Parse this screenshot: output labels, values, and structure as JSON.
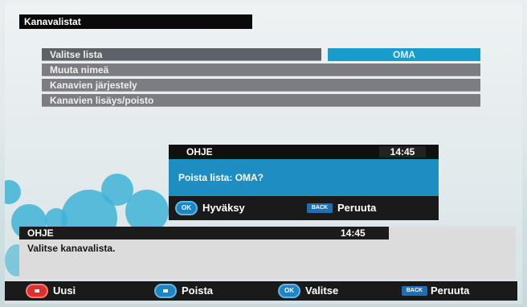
{
  "menu": {
    "title": "Kanavalistat",
    "items": [
      {
        "label": "Valitse lista",
        "value": "OMA"
      },
      {
        "label": "Muuta nimeä"
      },
      {
        "label": "Kanavien järjestely"
      },
      {
        "label": "Kanavien lisäys/poisto"
      }
    ]
  },
  "dialog": {
    "header": "OHJE",
    "time": "14:45",
    "message": "Poista lista: OMA?",
    "ok_icon": "OK",
    "ok_label": "Hyväksy",
    "back_icon": "BACK",
    "back_label": "Peruuta"
  },
  "info": {
    "header": "OHJE",
    "time": "14:45",
    "text": "Valitse kanavalista."
  },
  "bottom": {
    "red_label": "Uusi",
    "blue_label": "Poista",
    "ok_icon": "OK",
    "ok_label": "Valitse",
    "back_icon": "BACK",
    "back_label": "Peruuta"
  },
  "colors": {
    "accent": "#1e8ec2",
    "red_button": "#e0302c"
  }
}
